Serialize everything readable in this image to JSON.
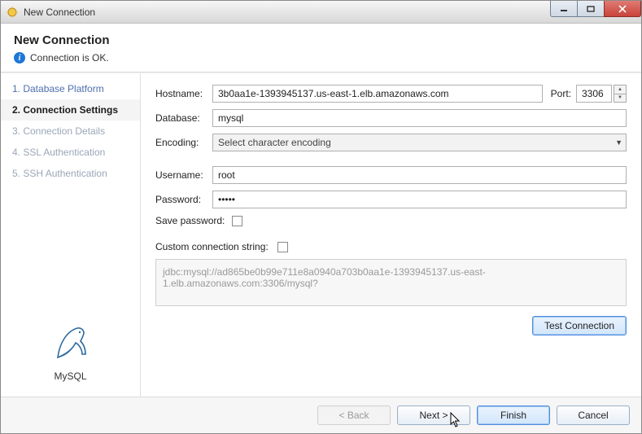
{
  "titlebar": {
    "title": "New Connection"
  },
  "header": {
    "heading": "New Connection",
    "status": "Connection is OK."
  },
  "sidebar": {
    "steps": [
      {
        "label": "1. Database Platform"
      },
      {
        "label": "2. Connection Settings"
      },
      {
        "label": "3. Connection Details"
      },
      {
        "label": "4. SSL Authentication"
      },
      {
        "label": "5. SSH Authentication"
      }
    ],
    "tech_label": "MySQL"
  },
  "form": {
    "hostname_label": "Hostname:",
    "hostname_value": "3b0aa1e-1393945137.us-east-1.elb.amazonaws.com",
    "port_label": "Port:",
    "port_value": "3306",
    "database_label": "Database:",
    "database_value": "mysql",
    "encoding_label": "Encoding:",
    "encoding_selected": "Select character encoding",
    "username_label": "Username:",
    "username_value": "root",
    "password_label": "Password:",
    "password_value": "•••••",
    "save_password_label": "Save password:",
    "custom_conn_label": "Custom connection string:",
    "conn_string_value": "jdbc:mysql://ad865be0b99e711e8a0940a703b0aa1e-1393945137.us-east-1.elb.amazonaws.com:3306/mysql?",
    "test_button": "Test Connection"
  },
  "footer": {
    "back": "< Back",
    "next": "Next >",
    "finish": "Finish",
    "cancel": "Cancel"
  }
}
